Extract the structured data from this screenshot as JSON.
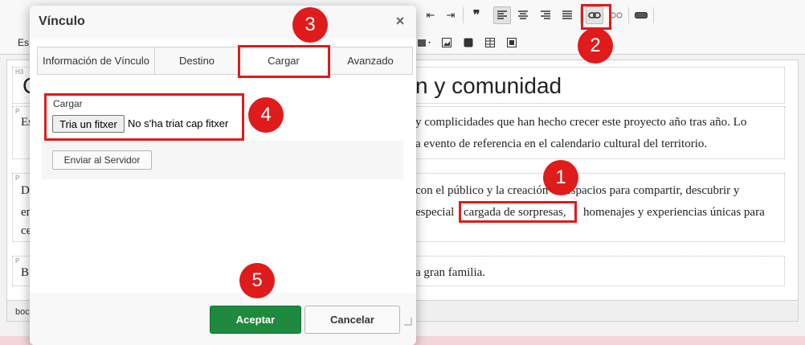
{
  "dialog": {
    "title": "Vínculo",
    "close_glyph": "×",
    "tabs": [
      {
        "label": "Información de Vínculo"
      },
      {
        "label": "Destino"
      },
      {
        "label": "Cargar"
      },
      {
        "label": "Avanzado"
      }
    ],
    "selected_tab": "Cargar",
    "upload": {
      "label": "Cargar",
      "file_button_label": "Tria un fitxer",
      "file_status": "No s'ha triat cap fitxer"
    },
    "send_button_label": "Enviar al Servidor",
    "accept_label": "Aceptar",
    "cancel_label": "Cancelar",
    "accept_color": "#1e8a3e"
  },
  "editor": {
    "toolbar": {
      "quote_glyph": "❞",
      "link_icon": "link-icon",
      "unlink_icon": "unlink-icon",
      "hr_icon": "horizontal-rule-icon",
      "style_label_fragment": "Es"
    },
    "blocks": [
      {
        "tag": "H3",
        "text_fragment": "C",
        "text_right": "n y comunidad"
      },
      {
        "tag": "P",
        "line1_left": "Es",
        "line1_right": "y complicidades que han hecho crecer este proyecto año tras año. Lo",
        "line2_right": "a evento de referencia en el calendario cultural del territorio."
      },
      {
        "tag": "P",
        "line1_left": "D",
        "line1_right": "con el público y la creación de espacios para compartir, descubrir y",
        "line2_left": "en",
        "line2_mid": "especial",
        "line2_highlight": "cargada de sorpresas,",
        "line2_right": "homenajes y experiencias únicas para",
        "line3_left": "ce"
      },
      {
        "tag": "P",
        "line1_left": "B",
        "line1_right": "a gran familia."
      }
    ],
    "statusbar_text": "boc"
  },
  "annotations": [
    {
      "number": "1"
    },
    {
      "number": "2"
    },
    {
      "number": "3"
    },
    {
      "number": "4"
    },
    {
      "number": "5"
    }
  ],
  "colors": {
    "annotation_red": "#e01b1b"
  }
}
